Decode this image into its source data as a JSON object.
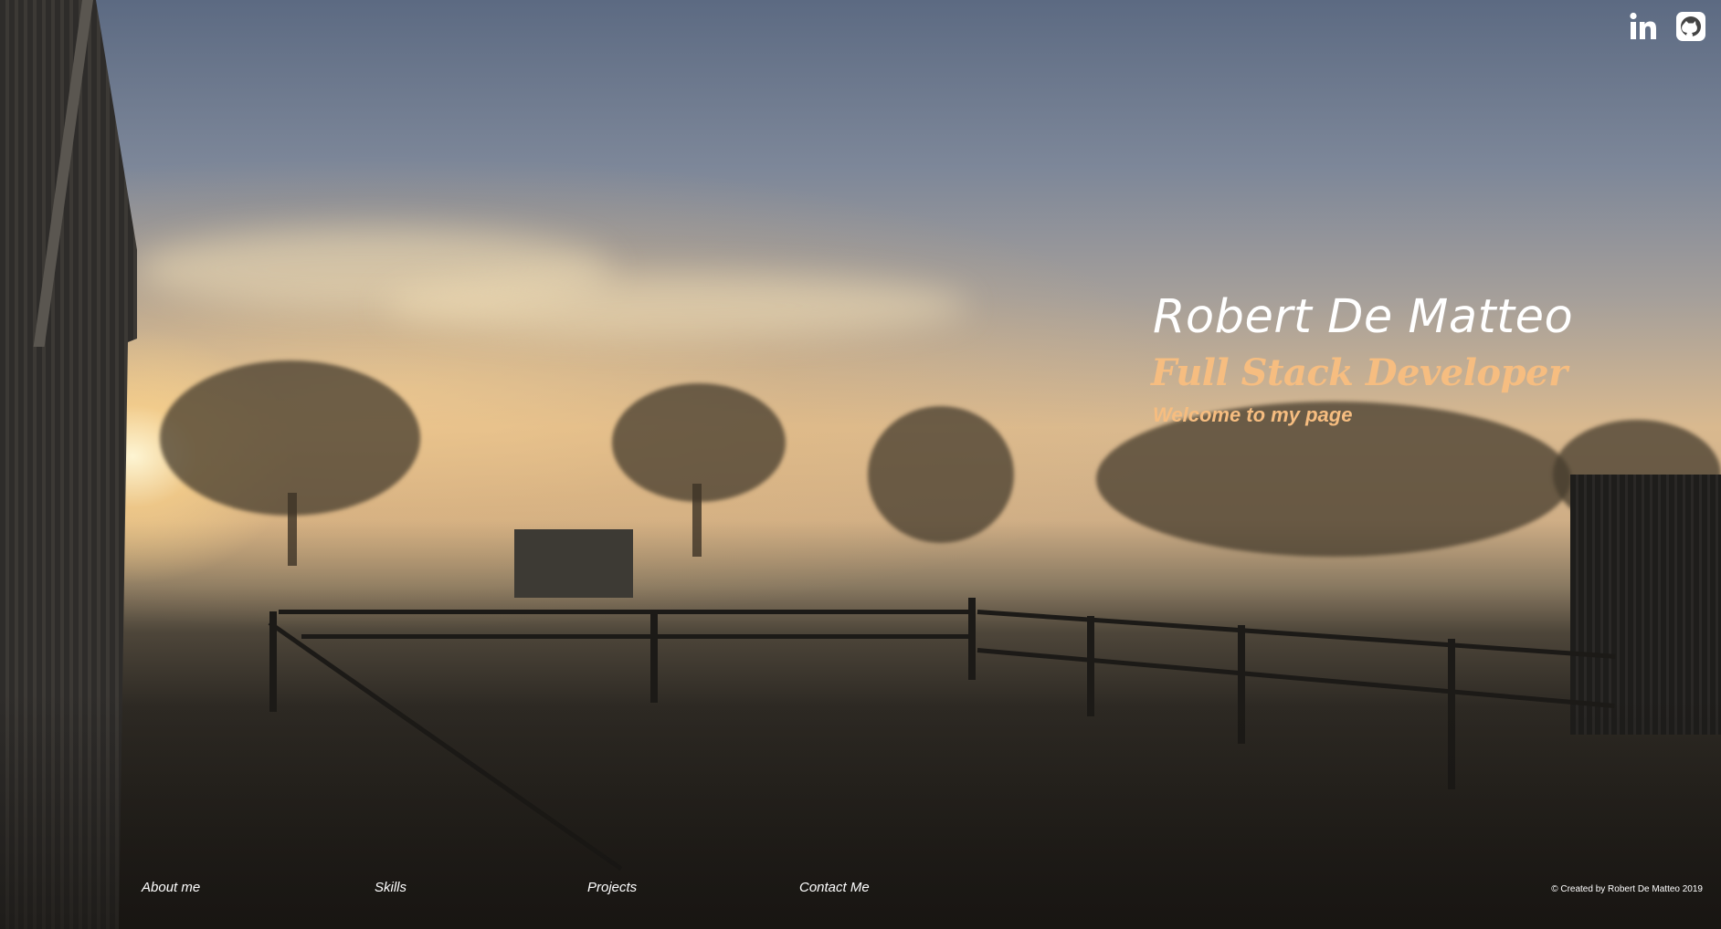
{
  "header": {
    "social": [
      {
        "icon": "linkedin-icon",
        "label": "in"
      },
      {
        "icon": "github-icon",
        "label": "GitHub"
      }
    ]
  },
  "intro": {
    "name": "Robert De Matteo",
    "role": "Full Stack Developer",
    "welcome": "Welcome to my page"
  },
  "nav": {
    "about": "About me",
    "skills": "Skills",
    "projects": "Projects",
    "contact": "Contact Me"
  },
  "footer": {
    "copyright": "© Created by Robert De Matteo 2019"
  },
  "colors": {
    "accent": "#f6bd80",
    "text": "#ffffff"
  }
}
